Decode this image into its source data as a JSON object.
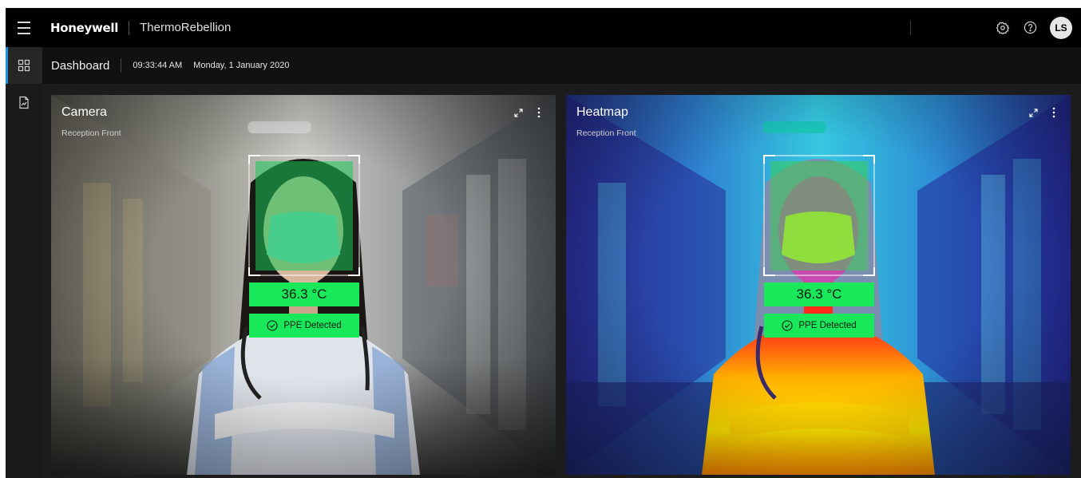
{
  "header": {
    "brand": "Honeywell",
    "app_name": "ThermoRebellion",
    "user_initials": "LS"
  },
  "subheader": {
    "page_title": "Dashboard",
    "time": "09:33:44 AM",
    "date": "Monday, 1 January 2020"
  },
  "panels": [
    {
      "title": "Camera",
      "location": "Reception Front",
      "temperature": "36.3 °C",
      "ppe_status": "PPE Detected"
    },
    {
      "title": "Heatmap",
      "location": "Reception Front",
      "temperature": "36.3 °C",
      "ppe_status": "PPE Detected"
    }
  ],
  "icons": {
    "menu": "hamburger-icon",
    "settings": "gear-icon",
    "help": "question-icon",
    "dashboard": "grid-icon",
    "reports": "report-icon",
    "expand": "expand-icon",
    "more": "more-vertical-icon",
    "ppe": "check-circle-icon"
  },
  "colors": {
    "accent": "#1792e5",
    "detection_green": "#19e85a",
    "topbar": "#000000",
    "background": "#1c1c1c"
  }
}
